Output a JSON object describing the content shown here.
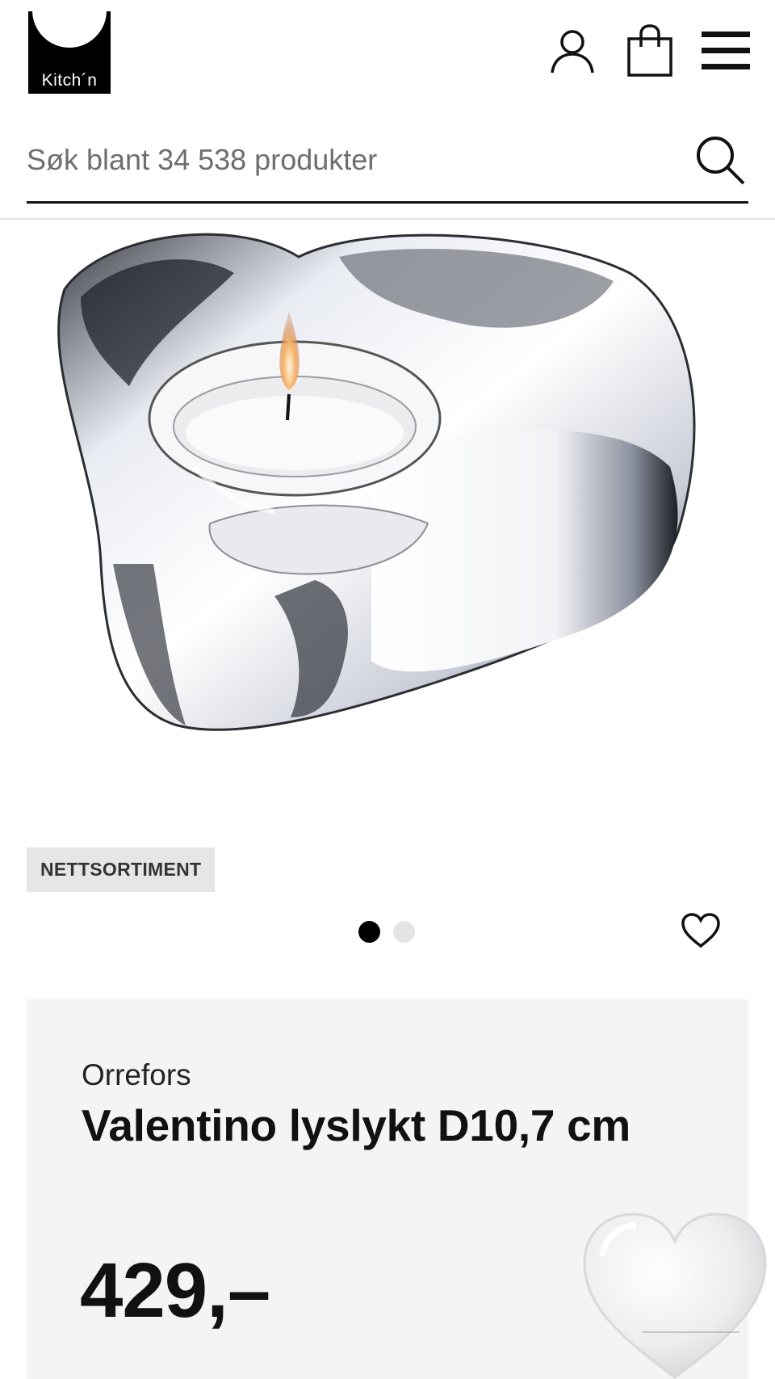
{
  "header": {
    "logo_text": "Kitch´n",
    "icons": [
      "user-icon",
      "shopping-bag-icon",
      "hamburger-menu-icon"
    ]
  },
  "search": {
    "placeholder": "Søk blant 34 538 produkter",
    "value": "",
    "icon": "search-icon"
  },
  "product": {
    "badge": "NETTSORTIMENT",
    "carousel": {
      "total": 2,
      "active": 1
    },
    "brand": "Orrefors",
    "name": "Valentino lyslykt D10,7 cm",
    "price": "429,–",
    "favorite_icon": "heart-outline-icon"
  },
  "overlay": {
    "icon": "heart-3d-icon"
  },
  "colors": {
    "text": "#111111",
    "panel_bg": "#f4f4f4",
    "badge_bg": "#e6e6e6",
    "dot_active": "#000000",
    "dot_inactive": "#e4e4e4"
  }
}
